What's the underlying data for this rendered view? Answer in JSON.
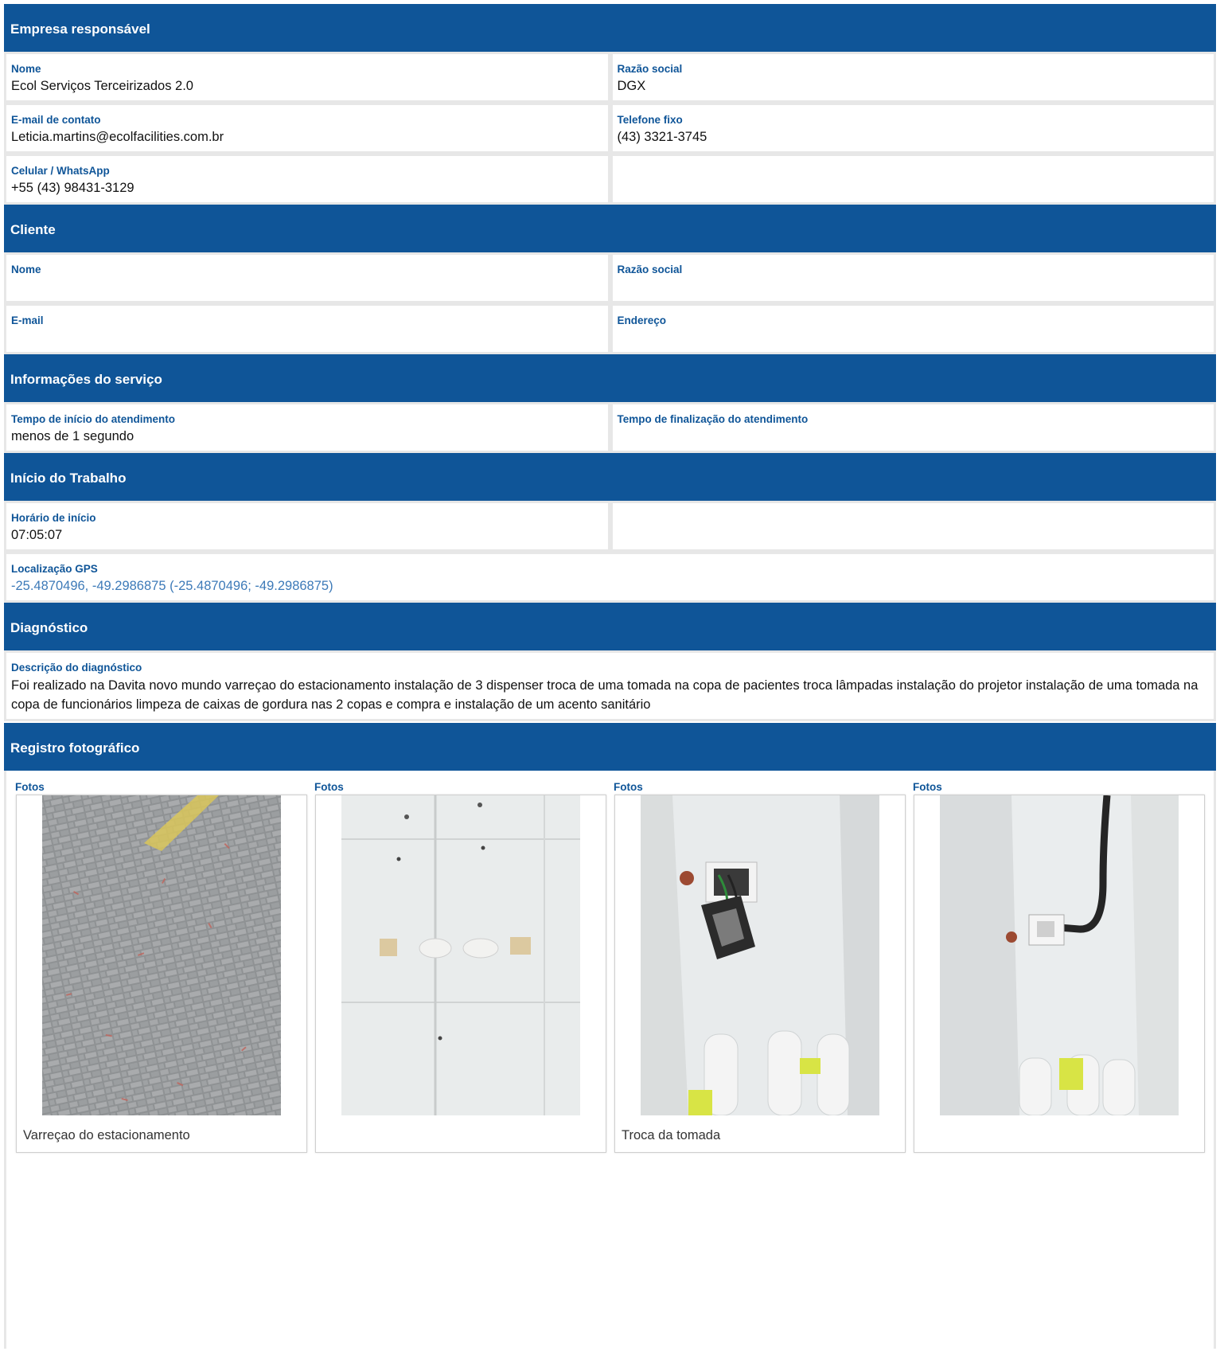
{
  "empresa": {
    "title": "Empresa responsável",
    "nome_label": "Nome",
    "nome": "Ecol Serviços Terceirizados 2.0",
    "razao_label": "Razão social",
    "razao": "DGX",
    "email_label": "E-mail de contato",
    "email": "Leticia.martins@ecolfacilities.com.br",
    "telefone_label": "Telefone fixo",
    "telefone": "(43) 3321-3745",
    "celular_label": "Celular / WhatsApp",
    "celular": "+55 (43) 98431-3129"
  },
  "cliente": {
    "title": "Cliente",
    "nome_label": "Nome",
    "razao_label": "Razão social",
    "email_label": "E-mail",
    "endereco_label": "Endereço"
  },
  "servico": {
    "title": "Informações do serviço",
    "inicio_label": "Tempo de início do atendimento",
    "inicio": "menos de 1 segundo",
    "fim_label": "Tempo de finalização do atendimento"
  },
  "trabalho": {
    "title": "Início do Trabalho",
    "horario_label": "Horário de início",
    "horario": "07:05:07",
    "gps_label": "Localização GPS",
    "gps": "-25.4870496, -49.2986875 (-25.4870496; -49.2986875)"
  },
  "diagnostico": {
    "title": "Diagnóstico",
    "descricao_label": "Descrição do diagnóstico",
    "descricao": "Foi realizado na Davita novo mundo varreçao do estacionamento instalação de 3 dispenser troca de uma tomada na copa de pacientes troca lâmpadas instalação do projetor instalação de uma tomada na copa de funcionários limpeza de caixas de gordura nas 2 copas e compra e instalação de um acento sanitário"
  },
  "fotos": {
    "title": "Registro fotográfico",
    "items": [
      {
        "label": "Fotos",
        "caption": "Varreçao do estacionamento"
      },
      {
        "label": "Fotos",
        "caption": ""
      },
      {
        "label": "Fotos",
        "caption": "Troca da tomada"
      },
      {
        "label": "Fotos",
        "caption": ""
      }
    ]
  },
  "colors": {
    "header": "#0f5598",
    "label": "#0f5598",
    "link": "#3d7ab8"
  }
}
